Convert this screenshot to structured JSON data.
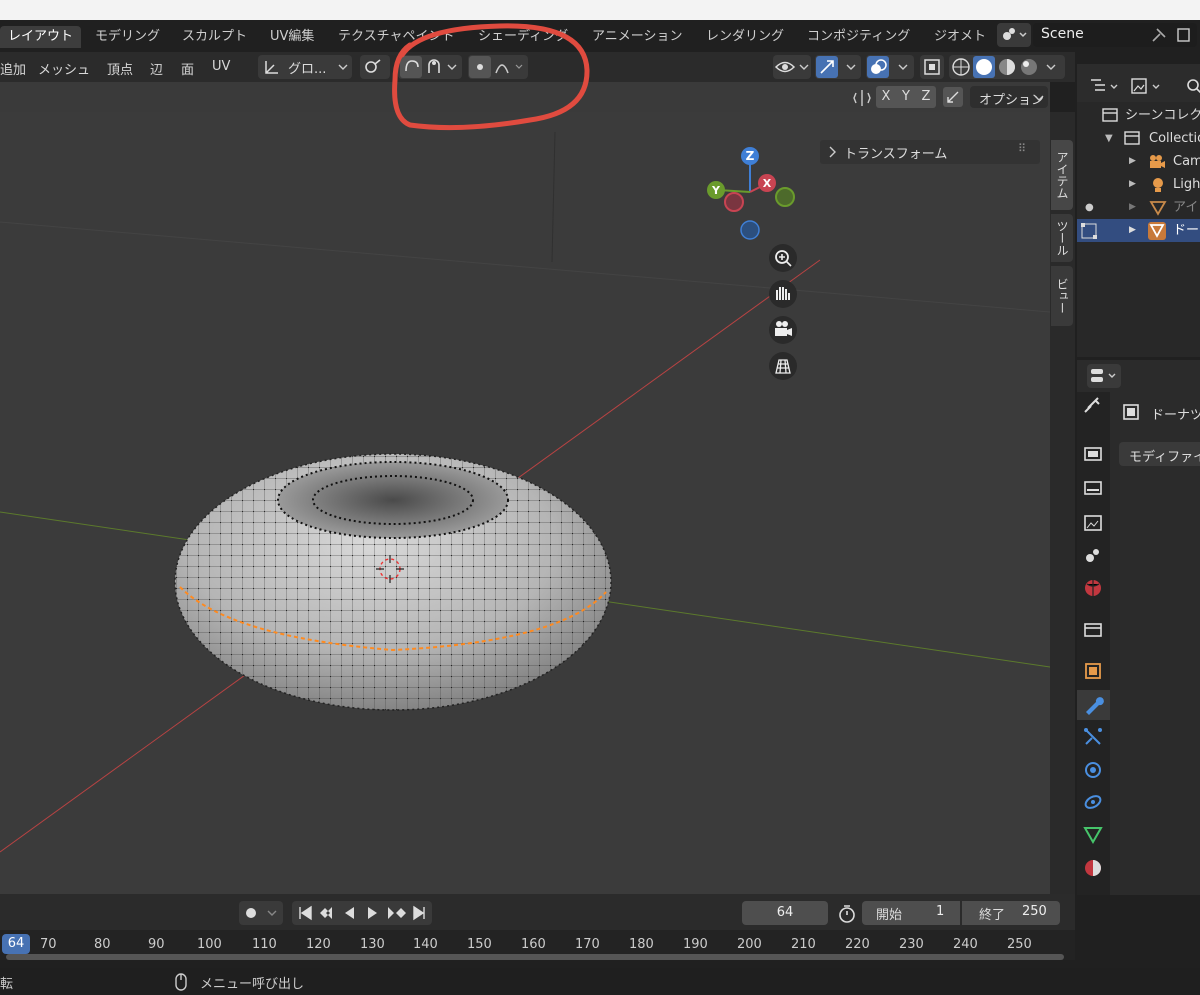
{
  "workspace_tabs": [
    "レイアウト",
    "モデリング",
    "スカルプト",
    "UV編集",
    "テクスチャペイント",
    "シェーディング",
    "アニメーション",
    "レンダリング",
    "コンポジティング",
    "ジオメト"
  ],
  "scene_name": "Scene",
  "header_menu": [
    "追加",
    "メッシュ",
    "頂点",
    "辺",
    "面",
    "UV"
  ],
  "transform_orientation": "グロ...",
  "axis_labels": [
    "X",
    "Y",
    "Z"
  ],
  "options_label": "オプション",
  "n_panel": {
    "transform_label": "トランスフォーム"
  },
  "n_tabs": [
    "アイテム",
    "ツール",
    "ビュー"
  ],
  "gizmo": {
    "x": "X",
    "y": "Y",
    "z": "Z"
  },
  "outliner": {
    "items": [
      "シーンコレク",
      "Collectio",
      "Cam",
      "Ligh",
      "アイ",
      "ドー"
    ]
  },
  "properties": {
    "object_name": "ドーナツ",
    "modifier_button": "モディファイ"
  },
  "timeline": {
    "current_frame": "64",
    "start_label": "開始",
    "start_value": "1",
    "end_label": "終了",
    "end_value": "250",
    "ruler_current": "64",
    "ruler_ticks": [
      "70",
      "80",
      "90",
      "100",
      "110",
      "120",
      "130",
      "140",
      "150",
      "160",
      "170",
      "180",
      "190",
      "200",
      "210",
      "220",
      "230",
      "240",
      "250"
    ]
  },
  "status": {
    "left": "転",
    "menu": "メニュー呼び出し"
  },
  "colors": {
    "accent": "#4772b3",
    "selection": "#ff8a1f",
    "annotation": "#e04b3f"
  }
}
